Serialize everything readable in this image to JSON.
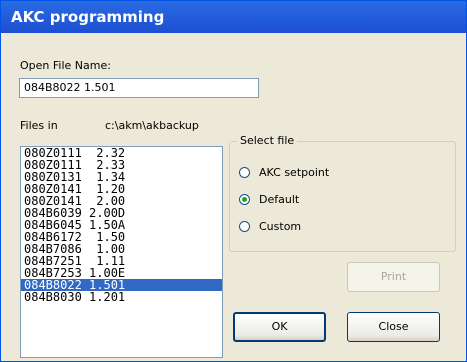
{
  "window": {
    "title": "AKC programming"
  },
  "open_file": {
    "label": "Open File Name:",
    "value": "084B8022 1.501"
  },
  "files": {
    "label": "Files in",
    "path": "c:\\akm\\akbackup",
    "items": [
      "080Z0111  2.32",
      "080Z0111  2.33",
      "080Z0131  1.34",
      "080Z0141  1.20",
      "080Z0141  2.00",
      "084B6039 2.00D",
      "084B6045 1.50A",
      "084B6172  1.50",
      "084B7086  1.00",
      "084B7251  1.11",
      "084B7253 1.00E",
      "084B8022 1.501",
      "084B8030 1.201"
    ],
    "selected_index": 11
  },
  "select_file": {
    "title": "Select file",
    "options": [
      "AKC setpoint",
      "Default",
      "Custom"
    ],
    "selected": "Default"
  },
  "buttons": {
    "print": "Print",
    "ok": "OK",
    "close": "Close"
  }
}
